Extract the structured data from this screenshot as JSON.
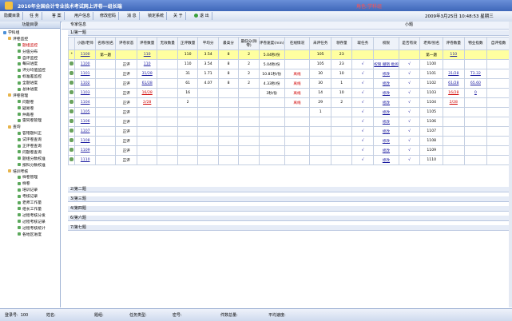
{
  "app": {
    "title": "2010年全国会计专业技术考试网上评卷—组长端",
    "role": "角色:学科组"
  },
  "toolbar": {
    "buttons": [
      "隐藏目录",
      "任 务",
      "答 案",
      "用户信息",
      "修改密码",
      "消 息",
      "锁定系统",
      "关 于",
      "退 出"
    ],
    "datetime": "2009年3月25日 10:48:53 星期三"
  },
  "sidebar": {
    "title": "功能目录",
    "items": [
      {
        "label": "学科组",
        "level": 0
      },
      {
        "label": "评卷监控",
        "level": 1
      },
      {
        "label": "题组监控",
        "level": 2,
        "active": true
      },
      {
        "label": "分值分布",
        "level": 2
      },
      {
        "label": "自评监控",
        "level": 2
      },
      {
        "label": "每日进度",
        "level": 2
      },
      {
        "label": "评分均值监控",
        "level": 2
      },
      {
        "label": "标准差监控",
        "level": 2
      },
      {
        "label": "全题进度",
        "level": 2
      },
      {
        "label": "总体进度",
        "level": 2
      },
      {
        "label": "评卷管理",
        "level": 1
      },
      {
        "label": "问题卷",
        "level": 2
      },
      {
        "label": "疑易卷",
        "level": 2
      },
      {
        "label": "仲裁卷",
        "level": 2
      },
      {
        "label": "雷同卷管理",
        "level": 2
      },
      {
        "label": "查询",
        "level": 1
      },
      {
        "label": "答错题纠正",
        "level": 2
      },
      {
        "label": "试评卷查询",
        "level": 2
      },
      {
        "label": "正评卷查询",
        "level": 2
      },
      {
        "label": "问题卷查询",
        "level": 2
      },
      {
        "label": "题组分数校准",
        "level": 2
      },
      {
        "label": "按科分数校准",
        "level": 2
      },
      {
        "label": "培训考核",
        "level": 1
      },
      {
        "label": "样卷管理",
        "level": 2
      },
      {
        "label": "样卷",
        "level": 2
      },
      {
        "label": "培训记录",
        "level": 2
      },
      {
        "label": "考核记录",
        "level": 2
      },
      {
        "label": "老师工作量",
        "level": 2
      },
      {
        "label": "组长工作量",
        "level": 2
      },
      {
        "label": "过程考核分发",
        "level": 2
      },
      {
        "label": "过程考核记录",
        "level": 2
      },
      {
        "label": "过程考核统计",
        "level": 2
      },
      {
        "label": "各地区进度",
        "level": 2
      }
    ]
  },
  "main": {
    "expert_tab": "专家信息",
    "small_tab": "小题",
    "first_section": "1/第一题",
    "columns": [
      "小题/老师",
      "名称/别名",
      "评卷状态",
      "评卷数量",
      "无效数量",
      "正评数量",
      "平均分",
      "最高分",
      "最低分(除零)",
      "评卷速度(min)",
      "在线情况",
      "未评任务",
      "领存量",
      "取任务",
      "权限",
      "是否有效",
      "老师/别名",
      "评卷数量",
      "物业指数",
      "自评指数"
    ],
    "summary_row": [
      "1100",
      "第一题",
      "",
      "110",
      "",
      "110",
      "3.54",
      "8",
      "2",
      "5.04秒/份",
      "",
      "105",
      "23",
      "",
      "",
      "",
      "第一题",
      "110",
      "",
      ""
    ],
    "rows": [
      [
        "1100",
        "",
        "正评",
        "110",
        "",
        "110",
        "3.54",
        "8",
        "2",
        "5.04秒/份",
        "",
        "105",
        "23",
        "√",
        "权限 撤销 批阅",
        "√",
        "1100",
        "",
        "",
        ""
      ],
      [
        "1101",
        "",
        "正评",
        "31/28",
        "",
        "31",
        "1.71",
        "8",
        "2",
        "10.81秒/份",
        "离线",
        "30",
        "10",
        "√",
        "修改",
        "√",
        "1101",
        "31/28",
        "T3.32",
        ""
      ],
      [
        "1102",
        "",
        "正评",
        "61/28",
        "",
        "61",
        "4.07",
        "8",
        "2",
        "4.33秒/份",
        "离线",
        "30",
        "1",
        "√",
        "修改",
        "√",
        "1102",
        "61/28",
        "65.60",
        ""
      ],
      [
        "1103",
        "",
        "正评",
        "16/28",
        "",
        "16",
        "",
        "",
        "",
        "3秒/份",
        "离线",
        "14",
        "10",
        "√",
        "修改",
        "√",
        "1103",
        "16/28",
        "0",
        ""
      ],
      [
        "1104",
        "",
        "正评",
        "2/28",
        "",
        "2",
        "",
        "",
        "",
        "",
        "离线",
        "29",
        "2",
        "√",
        "修改",
        "√",
        "1104",
        "2/28",
        "",
        ""
      ],
      [
        "1105",
        "",
        "正评",
        "",
        "",
        "",
        "",
        "",
        "",
        "",
        "",
        "1",
        "",
        "√",
        "修改",
        "√",
        "1105",
        "",
        "",
        ""
      ],
      [
        "1106",
        "",
        "正评",
        "",
        "",
        "",
        "",
        "",
        "",
        "",
        "",
        "",
        "",
        "√",
        "修改",
        "√",
        "1106",
        "",
        "",
        ""
      ],
      [
        "1107",
        "",
        "正评",
        "",
        "",
        "",
        "",
        "",
        "",
        "",
        "",
        "",
        "",
        "√",
        "修改",
        "√",
        "1107",
        "",
        "",
        ""
      ],
      [
        "1108",
        "",
        "正评",
        "",
        "",
        "",
        "",
        "",
        "",
        "",
        "",
        "",
        "",
        "√",
        "修改",
        "√",
        "1108",
        "",
        "",
        ""
      ],
      [
        "1109",
        "",
        "正评",
        "",
        "",
        "",
        "",
        "",
        "",
        "",
        "",
        "",
        "",
        "√",
        "修改",
        "√",
        "1109",
        "",
        "",
        ""
      ],
      [
        "1110",
        "",
        "正评",
        "",
        "",
        "",
        "",
        "",
        "",
        "",
        "",
        "",
        "",
        "√",
        "修改",
        "√",
        "1110",
        "",
        "",
        ""
      ]
    ],
    "sections": [
      "2/第二题",
      "3/第三题",
      "4/第四题",
      "6/第六题",
      "7/第七题"
    ]
  },
  "status": {
    "login_label": "登录号:",
    "login_value": "100",
    "name_label": "姓名:",
    "name_value": "",
    "group_label": "题组:",
    "group_value": "",
    "type_label": "任务类型:",
    "type_value": "",
    "paper_label": "密号:",
    "paper_value": "",
    "total_label": "件数总量:",
    "total_value": "",
    "speed_label": "平均速度:",
    "speed_value": ""
  }
}
